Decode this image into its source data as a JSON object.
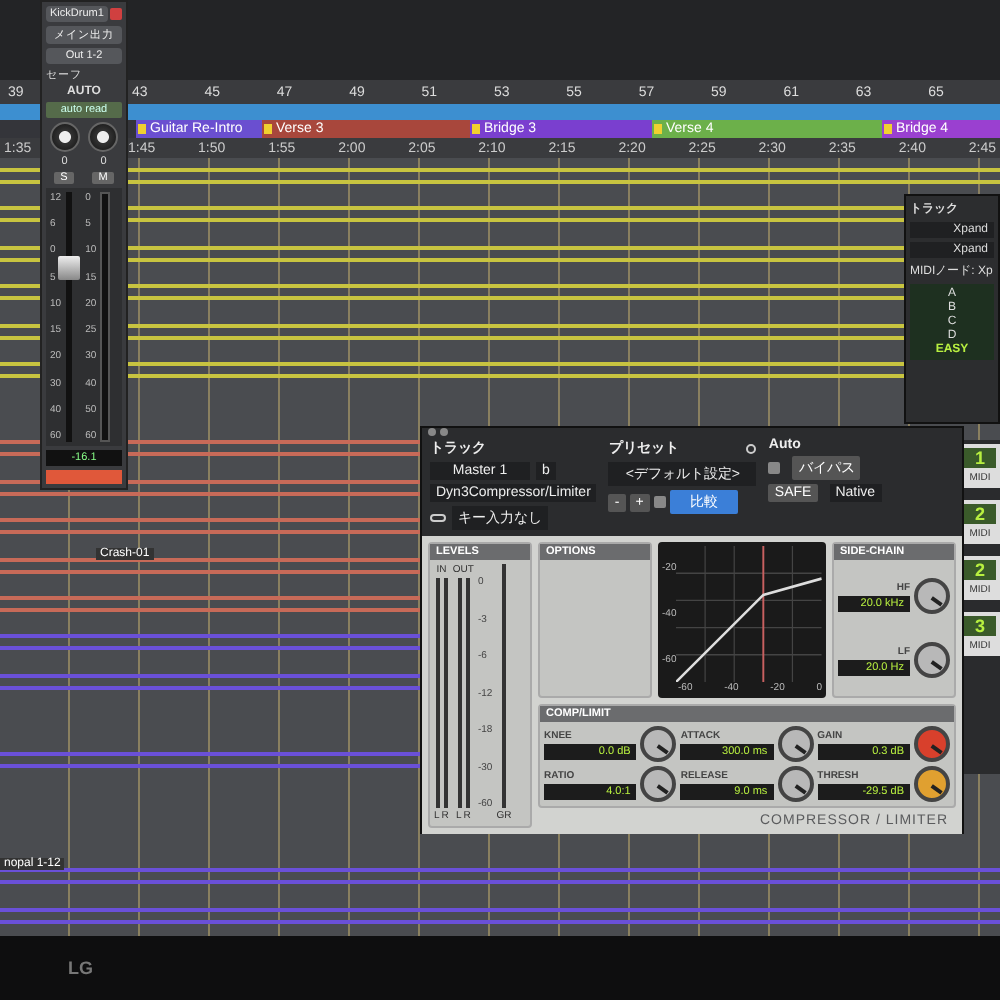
{
  "timeline": {
    "bars": [
      "39",
      "43",
      "45",
      "47",
      "49",
      "51",
      "53",
      "55",
      "57",
      "59",
      "61",
      "63",
      "65"
    ],
    "markers": [
      {
        "label": "Guitar Re-Intro",
        "color": "#6a4fd0"
      },
      {
        "label": "Verse 3",
        "color": "#a8473c"
      },
      {
        "label": "Bridge 3",
        "color": "#7a3fcf"
      },
      {
        "label": "Verse 4",
        "color": "#6cb04a"
      },
      {
        "label": "Bridge 4",
        "color": "#9a40d0"
      }
    ],
    "times": [
      "1:35",
      "1:45",
      "1:50",
      "1:55",
      "2:00",
      "2:05",
      "2:10",
      "2:15",
      "2:20",
      "2:25",
      "2:30",
      "2:35",
      "2:40",
      "2:45"
    ],
    "tracks": [
      {
        "kind": "audio",
        "color": "#c8c440"
      },
      {
        "kind": "audio",
        "color": "#c8c440"
      },
      {
        "kind": "audio",
        "color": "#c8c440"
      },
      {
        "kind": "audio",
        "color": "#c8c440"
      },
      {
        "kind": "audio",
        "color": "#c8c440"
      },
      {
        "kind": "audio",
        "color": "#c8c440"
      },
      {
        "kind": "empty"
      },
      {
        "kind": "audio",
        "color": "#c86a58"
      },
      {
        "kind": "audio",
        "color": "#c86a58"
      },
      {
        "kind": "audio",
        "color": "#c86a58"
      },
      {
        "kind": "audio",
        "color": "#c86a58",
        "clip": "Crash-01"
      },
      {
        "kind": "audio",
        "color": "#c86a58"
      },
      {
        "kind": "audio",
        "color": "#6a50d8"
      },
      {
        "kind": "audio",
        "color": "#6a50d8"
      },
      {
        "kind": "empty"
      },
      {
        "kind": "audio",
        "color": "#6a50d8"
      },
      {
        "kind": "empty"
      },
      {
        "kind": "empty"
      },
      {
        "kind": "audio",
        "color": "#6a50d8",
        "clip": "nopal 1-12"
      },
      {
        "kind": "audio",
        "color": "#6a50d8"
      }
    ]
  },
  "channel_strip": {
    "track": "KickDrum1",
    "output": "メイン出力",
    "bus": "Out 1-2",
    "safe": "セーフ",
    "automation_title": "AUTO",
    "automation_mode": "auto read",
    "pan_values": [
      "0",
      "0"
    ],
    "solo": "S",
    "mute": "M",
    "fader_scale": [
      "12",
      "6",
      "0",
      "5",
      "10",
      "15",
      "20",
      "30",
      "40",
      "60"
    ],
    "meter_scale": [
      "0",
      "5",
      "10",
      "15",
      "20",
      "25",
      "30",
      "40",
      "50",
      "60"
    ],
    "fader": {
      "level": 0.7
    },
    "volume": "-16.1",
    "color": "#e0583a"
  },
  "plugin": {
    "track_label": "トラック",
    "track": "Master 1",
    "slot": "b",
    "plugin_name": "Dyn3Compressor/Limiter",
    "key_input": "キー入力なし",
    "preset_label": "プリセット",
    "preset": "<デフォルト設定>",
    "preset_buttons": [
      "-",
      "+"
    ],
    "compare": "比較",
    "auto_label": "Auto",
    "bypass": "バイパス",
    "safe": "SAFE",
    "mode": "Native",
    "levels": {
      "title": "LEVELS",
      "in": "IN",
      "out": "OUT",
      "scale": [
        "0",
        "-3",
        "-6",
        "-12",
        "-18",
        "-30",
        "-60"
      ],
      "channels": [
        "L",
        "R",
        "L",
        "R"
      ],
      "gr": "GR"
    },
    "options_title": "OPTIONS",
    "graph": {
      "y_ticks": [
        "-20",
        "-40",
        "-60"
      ],
      "x_ticks": [
        "-60",
        "-40",
        "-20",
        "0"
      ]
    },
    "sidechain": {
      "title": "SIDE-CHAIN",
      "filters": [
        {
          "name": "HF",
          "value": "20.0 kHz"
        },
        {
          "name": "LF",
          "value": "20.0 Hz"
        }
      ]
    },
    "comp_title": "COMP/LIMIT",
    "knobs": [
      {
        "name": "KNEE",
        "value": "0.0 dB",
        "color": "#b8b8b8"
      },
      {
        "name": "ATTACK",
        "value": "300.0 ms",
        "color": "#b8b8b8"
      },
      {
        "name": "GAIN",
        "value": "0.3 dB",
        "color": "#d8402c"
      },
      {
        "name": "RATIO",
        "value": "4.0:1",
        "color": "#b8b8b8"
      },
      {
        "name": "RELEASE",
        "value": "9.0 ms",
        "color": "#b8b8b8"
      },
      {
        "name": "THRESH",
        "value": "-29.5 dB",
        "color": "#e0a030"
      }
    ],
    "footer": "COMPRESSOR / LIMITER"
  },
  "side_window": {
    "track_label": "トラック",
    "items": [
      "Xpand",
      "Xpand"
    ],
    "midi": "MIDIノード: Xp",
    "parts": [
      "A",
      "B",
      "C",
      "D"
    ],
    "mode": "EASY"
  },
  "instruments": [
    {
      "number": "1",
      "label": "MIDI"
    },
    {
      "number": "2",
      "label": "MIDI"
    },
    {
      "number": "2",
      "label": "MIDI"
    },
    {
      "number": "3",
      "label": "MIDI"
    }
  ],
  "bezel": {
    "logo": "LG"
  }
}
